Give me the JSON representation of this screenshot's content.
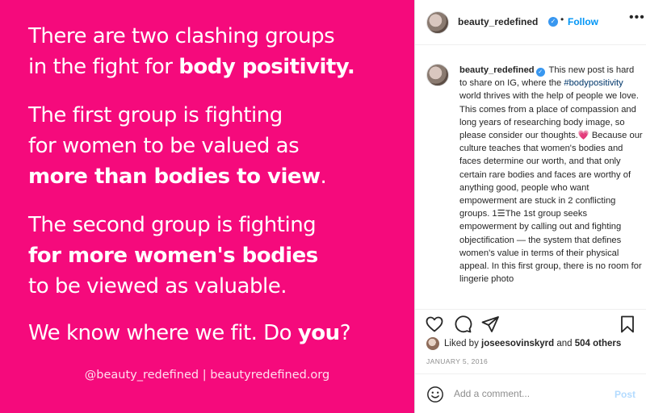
{
  "image": {
    "lines": [
      {
        "pre": "There are two clashing groups",
        "bold": "",
        "post": ""
      },
      {
        "pre": "in the fight for ",
        "bold": "body positivity.",
        "post": ""
      },
      {
        "pre": "The first group is fighting",
        "bold": "",
        "post": ""
      },
      {
        "pre": "for women to be valued as",
        "bold": "",
        "post": ""
      },
      {
        "pre": "",
        "bold": "more than bodies to view",
        "post": "."
      },
      {
        "pre": "The second group is fighting",
        "bold": "",
        "post": ""
      },
      {
        "pre": "",
        "bold": "for more women's bodies",
        "post": ""
      },
      {
        "pre": "to be viewed as valuable.",
        "bold": "",
        "post": ""
      },
      {
        "pre": "We know where we fit. Do ",
        "bold": "you",
        "post": "?"
      }
    ],
    "footer": "@beauty_redefined  |  beautyredefined.org",
    "background_color": "#f50a7c"
  },
  "header": {
    "username": "beauty_redefined",
    "separator": "•",
    "follow_label": "Follow",
    "more_label": "•••"
  },
  "caption": {
    "username": "beauty_redefined",
    "text_1": " This new post is hard to share on IG, where the ",
    "hashtag": "#bodypositivity",
    "text_2": " world thrives with the help of people we love. This comes from a place of compassion and long years of researching body image, so please consider our thoughts.",
    "heart": "💗",
    "text_3": " Because our culture teaches that women's bodies and faces determine our worth, and that only certain rare bodies and faces are worthy of anything good, people who want empowerment are stuck in 2 conflicting groups. 1",
    "list_glyph": "☰",
    "text_4": "The 1st group seeks empowerment by calling out and fighting objectification — the system that defines women's value in terms of their physical appeal. In this first group, there is no room for lingerie photo"
  },
  "likes": {
    "prefix": "Liked by ",
    "user": "joseesovinskyrd",
    "middle": " and ",
    "count": "504 others"
  },
  "date": "JANUARY 5, 2016",
  "comment": {
    "placeholder": "Add a comment...",
    "post_label": "Post"
  },
  "icons": {
    "verified": "verified-badge",
    "like": "heart-icon",
    "comment": "comment-icon",
    "share": "share-icon",
    "save": "bookmark-icon",
    "emoji": "emoji-icon"
  },
  "colors": {
    "accent": "#0095f6",
    "verified": "#3897f0",
    "hashtag": "#00376b",
    "post_disabled": "#b3dbff"
  }
}
